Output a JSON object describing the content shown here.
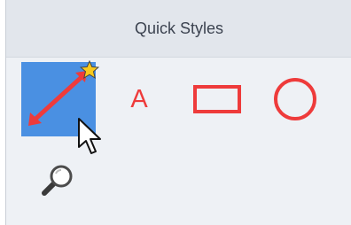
{
  "panel": {
    "title": "Quick Styles",
    "colors": {
      "accent": "#ee3b3b",
      "selected": "#4a90e2",
      "star": "#f8c91c"
    },
    "styles": [
      {
        "icon": "arrow-icon",
        "selected": true,
        "favorite": true
      },
      {
        "icon": "text-callout-icon",
        "label": "A"
      },
      {
        "icon": "rectangle-icon"
      },
      {
        "icon": "ellipse-icon"
      },
      {
        "icon": "magnifier-icon"
      }
    ],
    "pointer": "mouse-pointer-icon"
  }
}
